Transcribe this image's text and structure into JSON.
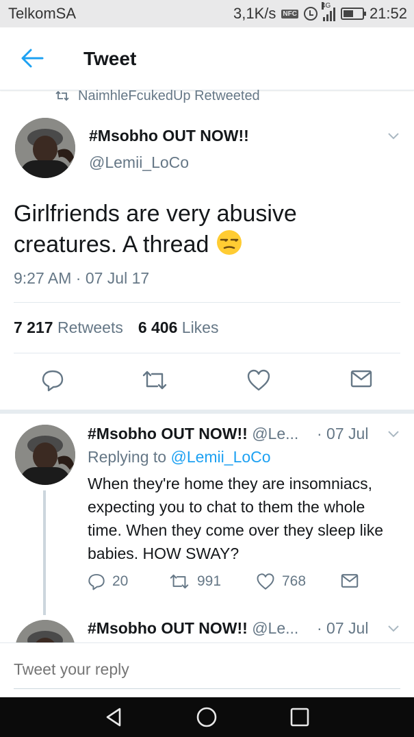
{
  "status_bar": {
    "carrier": "TelkomSA",
    "speed": "3,1K/s",
    "nfc": "NFC",
    "network": "4G",
    "time": "21:52"
  },
  "header": {
    "title": "Tweet"
  },
  "retweet_banner": "NaimhleFcukedUp Retweeted",
  "main_tweet": {
    "name": "#Msobho OUT NOW!!",
    "handle": "@Lemii_LoCo",
    "text": "Girlfriends are very abusive creatures. A thread",
    "emoji": "unamused-face",
    "timestamp": "9:27 AM · 07 Jul 17",
    "retweets_count": "7 217",
    "retweets_label": "Retweets",
    "likes_count": "6 406",
    "likes_label": "Likes"
  },
  "reply": {
    "name": "#Msobho OUT NOW!!",
    "handle": "@Le...",
    "date": "· 07 Jul",
    "replying_prefix": "Replying to",
    "replying_handle": "@Lemii_LoCo",
    "text": "When they're home they are insomniacs, expecting you to chat to them the whole time. When they come over they sleep like babies. HOW SWAY?",
    "reply_count": "20",
    "retweet_count": "991",
    "like_count": "768"
  },
  "reply2": {
    "name": "#Msobho OUT NOW!!",
    "handle": "@Le...",
    "date": "· 07 Jul"
  },
  "compose": {
    "placeholder": "Tweet your reply"
  },
  "colors": {
    "accent": "#1da1f2",
    "secondary_text": "#657786",
    "divider": "#e1e8ed"
  }
}
